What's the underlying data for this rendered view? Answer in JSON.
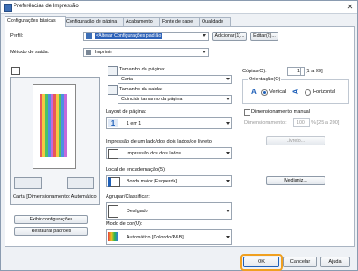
{
  "window": {
    "title": "Preferências de Impressão",
    "close": "✕"
  },
  "tabs": [
    "Configurações básicas",
    "Configuração de página",
    "Acabamento",
    "Fonte de papel",
    "Qualidade"
  ],
  "profile": {
    "label": "Perfil:",
    "value": "<Alterar Configurações padrão",
    "add": "Adicionar(1)...",
    "edit": "Editar(2)..."
  },
  "output": {
    "label": "Método de saída:",
    "value": "Imprimir"
  },
  "preview": {
    "caption": "Carta [Dimensionamento: Automático"
  },
  "left_buttons": {
    "view_settings": "Exibir configurações",
    "restore": "Restaurar padrões"
  },
  "page_size": {
    "label": "Tamanho da página:",
    "value": "Carta"
  },
  "output_size": {
    "label": "Tamanho da saída:",
    "value": "Coincidir tamanho da página"
  },
  "layout": {
    "label": "Layout de página:",
    "icon_text": "1",
    "value": "1 em 1"
  },
  "duplex": {
    "label": "Impressão de um lado/dos dois lados/de livreto:",
    "value": "Impressão dos dois lados"
  },
  "binding": {
    "label": "Local de encadernação(5):",
    "value": "Borda maior [Esquerda]"
  },
  "collate": {
    "label": "Agrupar/Classificar:",
    "value": "Desligado"
  },
  "color": {
    "label": "Modo de cor(U):",
    "value": "Automático [Colorido/P&B]"
  },
  "copies": {
    "label": "Cópias(C):",
    "value": "1",
    "range": "[1 a 99]"
  },
  "orientation": {
    "label": "Orientação(O)",
    "portrait": "Vertical",
    "landscape": "Horizontal",
    "a": "A"
  },
  "scaling": {
    "label": "Dimensionamento manual",
    "pct_label": "Dimensionamento:",
    "value": "100",
    "range": "% [25 a 200]"
  },
  "buttons": {
    "booklet": "Livreto...",
    "margin": "Medianiz...",
    "ok": "OK",
    "cancel": "Cancelar",
    "help": "Ajuda"
  },
  "colors": {
    "accent": "#1e5fb8",
    "ok_ring": "#f0a020"
  }
}
